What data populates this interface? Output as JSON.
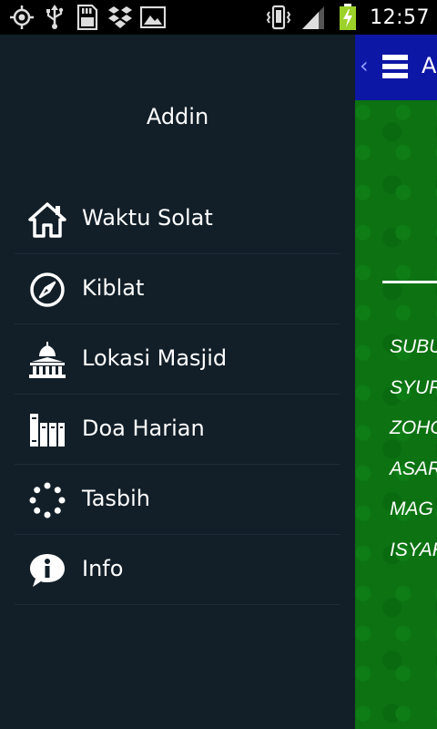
{
  "status_bar": {
    "time": "12:57",
    "left_icons": [
      "gps-icon",
      "usb-icon",
      "sd-card-icon",
      "dropbox-icon",
      "gallery-icon"
    ],
    "right_icons": [
      "vibrate-icon",
      "signal-icon",
      "battery-charging-icon"
    ]
  },
  "app_bar": {
    "title": "A",
    "back_glyph": "‹",
    "color": "#0d17a5"
  },
  "content": {
    "background_color": "#0c7212",
    "prayer_times": [
      "SUBU",
      "SYUR",
      "ZOHO",
      "ASAR",
      "MAG",
      "ISYAK"
    ]
  },
  "drawer": {
    "title": "Addin",
    "background_color": "#121f28",
    "items": [
      {
        "label": "Waktu Solat",
        "icon": "home-icon"
      },
      {
        "label": "Kiblat",
        "icon": "compass-icon"
      },
      {
        "label": "Lokasi Masjid",
        "icon": "mosque-icon"
      },
      {
        "label": "Doa Harian",
        "icon": "books-icon"
      },
      {
        "label": "Tasbih",
        "icon": "tasbih-icon"
      },
      {
        "label": "Info",
        "icon": "info-icon"
      }
    ]
  }
}
